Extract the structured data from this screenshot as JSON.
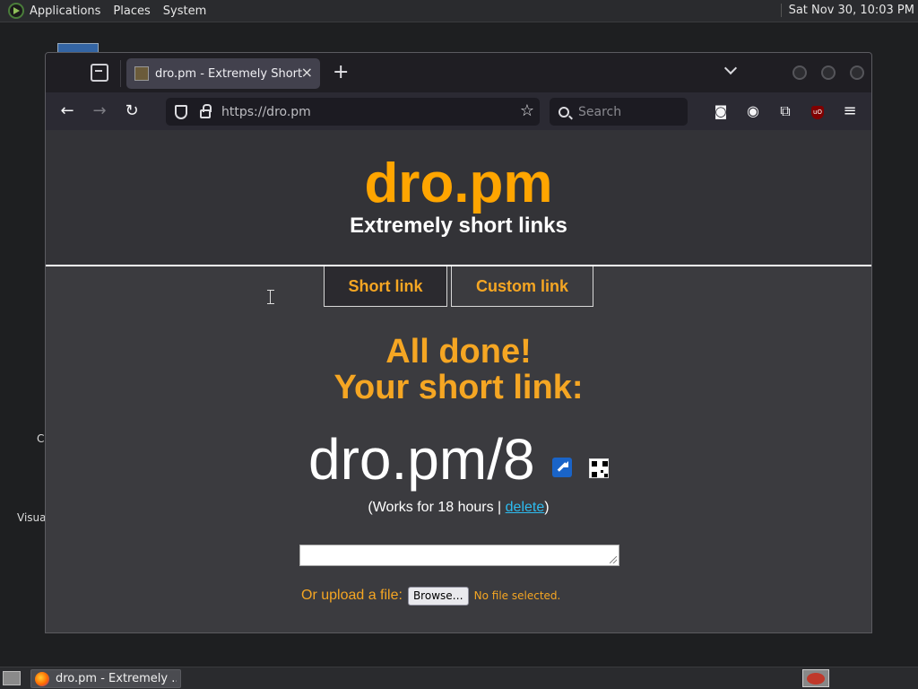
{
  "top_panel": {
    "menus": [
      "Applications",
      "Places",
      "System"
    ],
    "clock": "Sat Nov 30, 10:03 PM"
  },
  "desktop": {
    "labels": [
      "C",
      "Visua"
    ]
  },
  "browser": {
    "tab": {
      "title": "dro.pm - Extremely Short Li",
      "close": "×"
    },
    "new_tab": "+",
    "url": "https://dro.pm",
    "search_placeholder": "Search"
  },
  "page": {
    "site_title": "dro.pm",
    "site_subtitle": "Extremely short links",
    "tabs": [
      {
        "label": "Short link",
        "active": true
      },
      {
        "label": "Custom link",
        "active": false
      }
    ],
    "done_line1": "All done!",
    "done_line2": "Your short link:",
    "short_link": "dro.pm/8",
    "works_prefix": "(Works for 18 hours | ",
    "delete_link": "delete",
    "works_suffix": ")",
    "text_value": "",
    "upload_label": "Or upload a file:",
    "browse_label": "Browse…",
    "no_file": "No file selected."
  },
  "taskbar": {
    "task_label": "dro.pm - Extremely ..."
  },
  "colors": {
    "accent": "#ffa500",
    "link": "#2dbcf0",
    "page_bg": "#3b3b3f"
  }
}
